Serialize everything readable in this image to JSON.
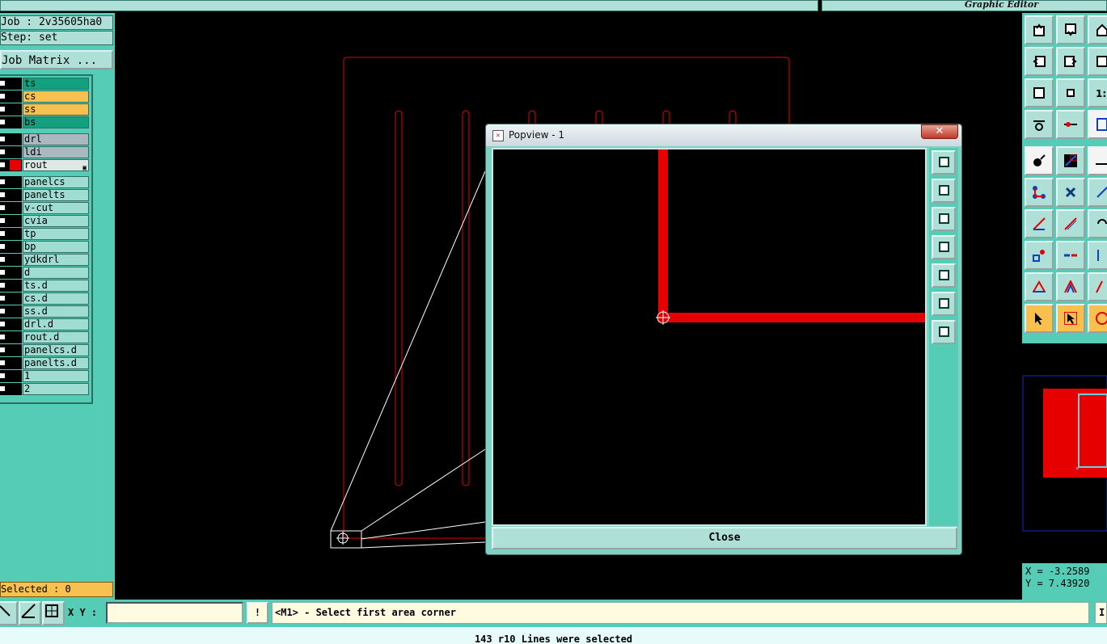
{
  "window": {
    "app_title": "Graphic Editor"
  },
  "job": {
    "job_label": "Job : 2v35605ha0",
    "step_label": "Step: set",
    "matrix_button": "Job Matrix ..."
  },
  "layers": [
    {
      "name": "ts",
      "style": "green"
    },
    {
      "name": "cs",
      "style": "orange"
    },
    {
      "name": "ss",
      "style": "orange"
    },
    {
      "name": "bs",
      "style": "green"
    },
    {
      "name": "drl",
      "style": "gray"
    },
    {
      "name": "ldi",
      "style": "gray"
    },
    {
      "name": "rout",
      "style": "sel"
    },
    {
      "name": "panelcs",
      "style": ""
    },
    {
      "name": "panelts",
      "style": ""
    },
    {
      "name": "v-cut",
      "style": ""
    },
    {
      "name": "cvia",
      "style": ""
    },
    {
      "name": "tp",
      "style": ""
    },
    {
      "name": "bp",
      "style": ""
    },
    {
      "name": "ydkdrl",
      "style": ""
    },
    {
      "name": "d",
      "style": ""
    },
    {
      "name": "ts.d",
      "style": ""
    },
    {
      "name": "cs.d",
      "style": ""
    },
    {
      "name": "ss.d",
      "style": ""
    },
    {
      "name": "drl.d",
      "style": ""
    },
    {
      "name": "rout.d",
      "style": ""
    },
    {
      "name": "panelcs.d",
      "style": ""
    },
    {
      "name": "panelts.d",
      "style": ""
    },
    {
      "name": "1",
      "style": ""
    },
    {
      "name": "2",
      "style": ""
    }
  ],
  "selected_label": "Selected : 0",
  "popview": {
    "title": "Popview - 1",
    "close_label": "Close",
    "close_x": "✕"
  },
  "coords": {
    "x": "X = -3.2589",
    "y": "Y = 7.43920"
  },
  "bottom": {
    "xy_label": "X Y :",
    "xy_value": "",
    "warn": "!",
    "prompt": "<M1> - Select first area corner",
    "right_stub": "I"
  },
  "status": "143 r10 Lines were selected",
  "colors": {
    "panel": "#55ccb5",
    "rout": "#e60000",
    "highlight": "#f8c04e"
  }
}
